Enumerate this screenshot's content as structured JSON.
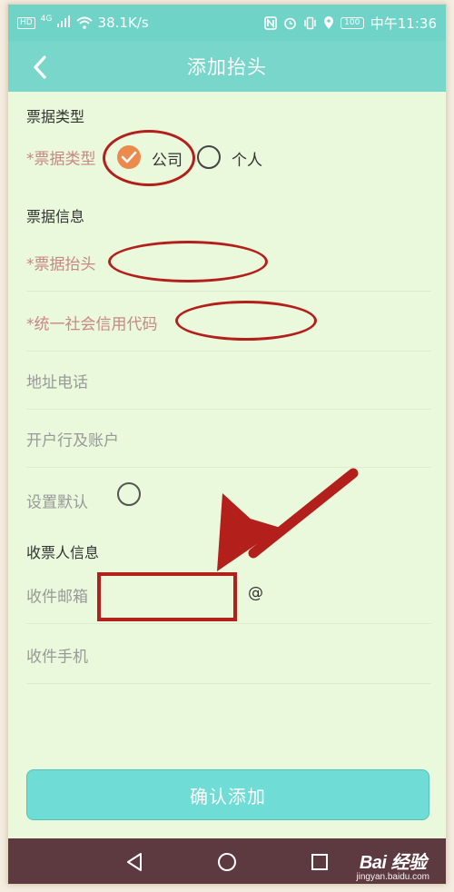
{
  "status_bar": {
    "hd": "HD",
    "network": "4G",
    "speed": "38.1K/s",
    "battery": "100",
    "time": "中午11:36"
  },
  "header": {
    "title": "添加抬头"
  },
  "sections": {
    "invoice_type": "票据类型",
    "invoice_info": "票据信息",
    "recipient_info": "收票人信息"
  },
  "form": {
    "type_label": "*票据类型",
    "type_options": [
      {
        "label": "公司",
        "selected": true
      },
      {
        "label": "个人",
        "selected": false
      }
    ],
    "title_label": "*票据抬头",
    "title_value": "",
    "credit_code_label": "*统一社会信用代码",
    "credit_code_value": "",
    "address_phone_label": "地址电话",
    "bank_account_label": "开户行及账户",
    "default_label": "设置默认",
    "email_label": "收件邮箱",
    "email_value": "",
    "email_at": "@",
    "phone_label": "收件手机"
  },
  "confirm_button": "确认添加",
  "watermark": {
    "logo": "Bai 经验",
    "url": "jingyan.baidu.com"
  },
  "colors": {
    "status_bar": "#6fd3c8",
    "title_bar": "#78d6cb",
    "background": "#eaf8dc",
    "accent": "#ec8a4d",
    "required": "#c98686",
    "annotation": "#b3201c",
    "confirm": "#6fdcd6",
    "nav_bar": "#5d3a40"
  }
}
